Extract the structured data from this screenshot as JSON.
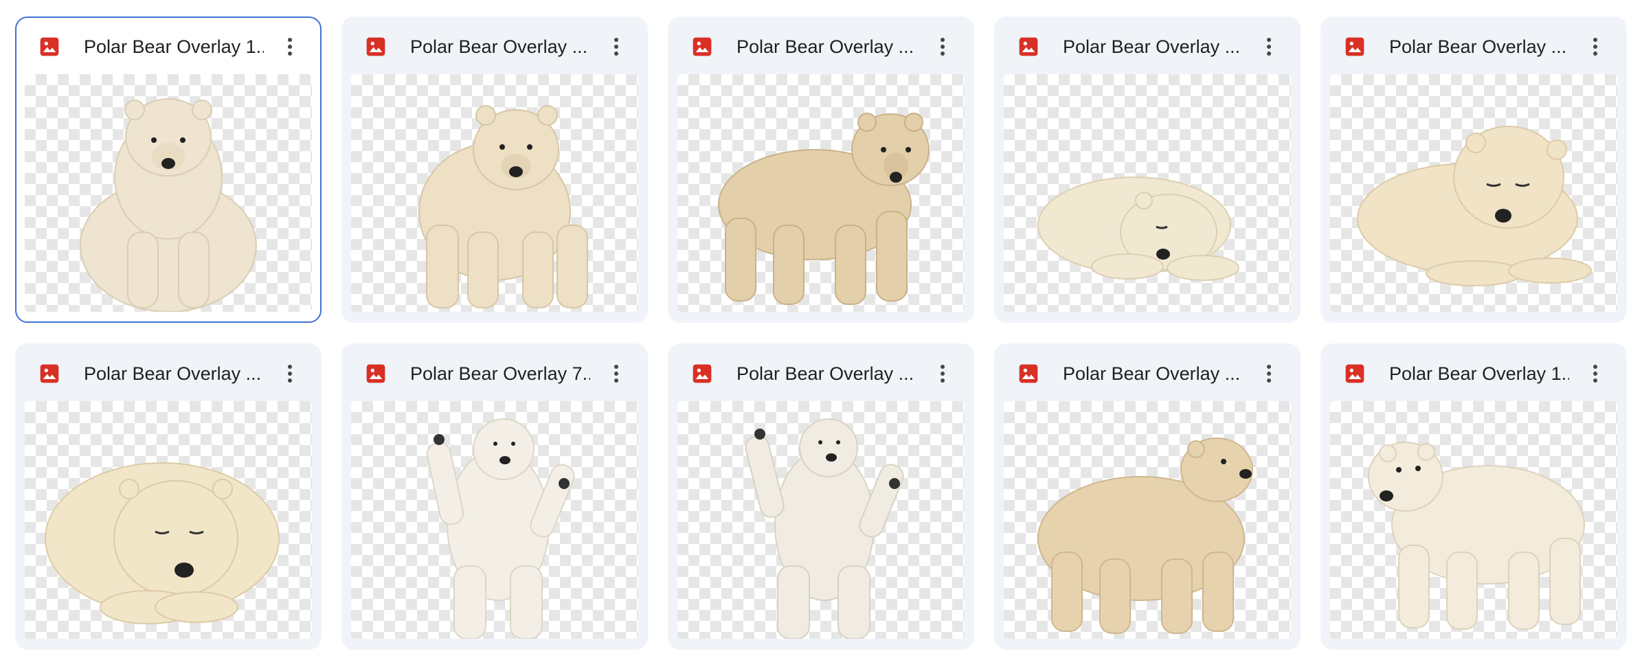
{
  "colors": {
    "card_bg": "#f0f4f9",
    "selected_border": "#3f70d8",
    "image_icon_red": "#d93025",
    "title_text": "#1f1f1f",
    "more_icon": "#444746"
  },
  "files": [
    {
      "title": "Polar Bear Overlay 1...",
      "icon": "image-file-icon",
      "pose": "sitting-front",
      "selected": true
    },
    {
      "title": "Polar Bear Overlay ...",
      "icon": "image-file-icon",
      "pose": "standing-front"
    },
    {
      "title": "Polar Bear Overlay ...",
      "icon": "image-file-icon",
      "pose": "walking-right"
    },
    {
      "title": "Polar Bear Overlay ...",
      "icon": "image-file-icon",
      "pose": "sleeping-right"
    },
    {
      "title": "Polar Bear Overlay ...",
      "icon": "image-file-icon",
      "pose": "resting-right"
    },
    {
      "title": "Polar Bear Overlay ...",
      "icon": "image-file-icon",
      "pose": "curled-sleeping"
    },
    {
      "title": "Polar Bear Overlay 7...",
      "icon": "image-file-icon",
      "pose": "dancing-upright"
    },
    {
      "title": "Polar Bear Overlay ...",
      "icon": "image-file-icon",
      "pose": "dancing-upright-2"
    },
    {
      "title": "Polar Bear Overlay ...",
      "icon": "image-file-icon",
      "pose": "standing-looking-up"
    },
    {
      "title": "Polar Bear Overlay 1...",
      "icon": "image-file-icon",
      "pose": "walking-left"
    }
  ]
}
